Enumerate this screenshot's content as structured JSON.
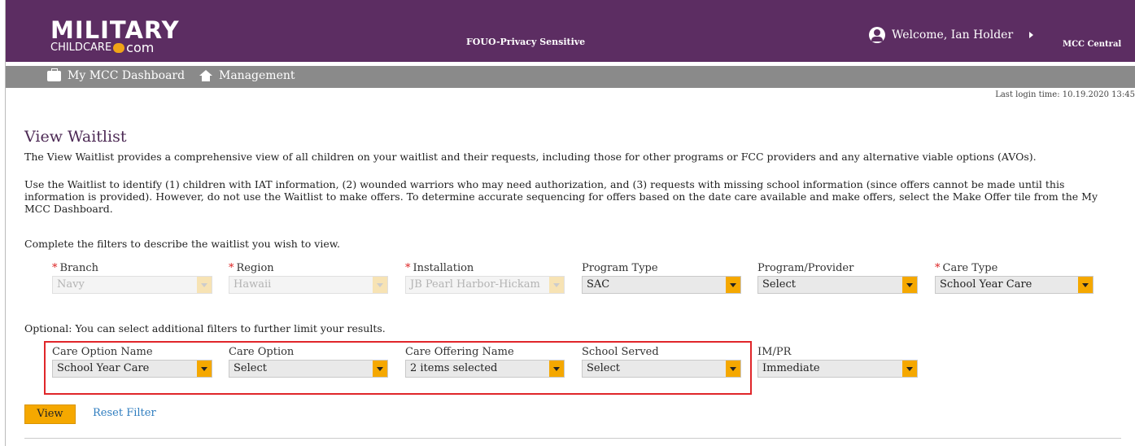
{
  "header": {
    "logo_main": "MILITARY",
    "logo_sub": "CHILDCARE",
    "logo_domain": "com",
    "classification": "FOUO-Privacy Sensitive",
    "welcome": "Welcome, Ian Holder",
    "mcc_central": "MCC Central",
    "brand_color": "#5c2d62"
  },
  "nav": {
    "dashboard": "My MCC Dashboard",
    "management": "Management"
  },
  "last_login": "Last login time: 10.19.2020 13:45",
  "page": {
    "title": "View Waitlist",
    "intro": "The View Waitlist provides a comprehensive view of all children on your waitlist and their requests, including those for other programs or FCC providers and any alternative viable options (AVOs).",
    "usage": "Use the Waitlist to identify (1) children with IAT information, (2) wounded warriors who may need authorization, and (3) requests with missing school information (since offers cannot be made until this information is provided). However, do not use the Waitlist to make offers. To determine accurate sequencing for offers based on the date care available and make offers, select the Make Offer tile from the My MCC Dashboard.",
    "filters_instructions": "Complete the filters to describe the waitlist you wish to view.",
    "optional_instructions": "Optional: You can select additional filters to further limit your results."
  },
  "filters": {
    "branch": {
      "label": "Branch",
      "value": "Navy"
    },
    "region": {
      "label": "Region",
      "value": "Hawaii"
    },
    "installation": {
      "label": "Installation",
      "value": "JB Pearl Harbor-Hickam"
    },
    "program_type": {
      "label": "Program Type",
      "value": "SAC"
    },
    "program_provider": {
      "label": "Program/Provider",
      "value": "Select"
    },
    "care_type": {
      "label": "Care Type",
      "value": "School Year Care"
    }
  },
  "optional_filters": {
    "care_option_name": {
      "label": "Care Option Name",
      "value": "School Year Care"
    },
    "care_option": {
      "label": "Care Option",
      "value": "Select"
    },
    "care_offering_name": {
      "label": "Care Offering Name",
      "value": "2 items selected"
    },
    "school_served": {
      "label": "School Served",
      "value": "Select"
    },
    "im_pr": {
      "label": "IM/PR",
      "value": "Immediate"
    }
  },
  "actions": {
    "view": "View",
    "reset": "Reset Filter"
  },
  "colors": {
    "accent": "#f5a800",
    "required": "#d22222",
    "highlight_border": "#e0262a",
    "link": "#2f7dbf"
  }
}
